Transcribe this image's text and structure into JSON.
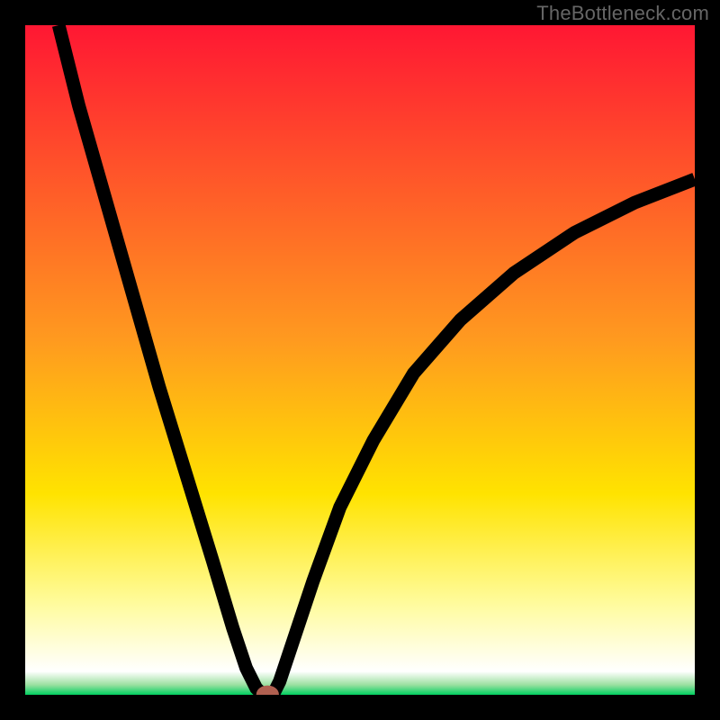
{
  "watermark": "TheBottleneck.com",
  "chart_data": {
    "type": "line",
    "title": "",
    "xlabel": "",
    "ylabel": "",
    "xlim": [
      0,
      100
    ],
    "ylim": [
      0,
      100
    ],
    "grid": false,
    "background_gradient": {
      "stops": [
        {
          "offset": 0.0,
          "color": "#ff1733"
        },
        {
          "offset": 0.47,
          "color": "#ff9a1f"
        },
        {
          "offset": 0.7,
          "color": "#ffe300"
        },
        {
          "offset": 0.86,
          "color": "#fffb99"
        },
        {
          "offset": 0.965,
          "color": "#ffffff"
        },
        {
          "offset": 0.985,
          "color": "#9ce0a1"
        },
        {
          "offset": 1.0,
          "color": "#00d060"
        }
      ]
    },
    "series": [
      {
        "name": "left-branch",
        "x": [
          5,
          8,
          12,
          16,
          20,
          24,
          28,
          31,
          33,
          34.5,
          35.5
        ],
        "y": [
          100,
          88,
          74,
          60,
          46,
          33,
          20,
          10,
          4,
          1,
          0
        ]
      },
      {
        "name": "right-branch",
        "x": [
          37,
          38,
          40,
          43,
          47,
          52,
          58,
          65,
          73,
          82,
          91,
          100
        ],
        "y": [
          0,
          2,
          8,
          17,
          28,
          38,
          48,
          56,
          63,
          69,
          73.5,
          77
        ]
      }
    ],
    "marker": {
      "x": 36.2,
      "y": 0,
      "rx": 1.2,
      "ry": 0.9
    }
  }
}
